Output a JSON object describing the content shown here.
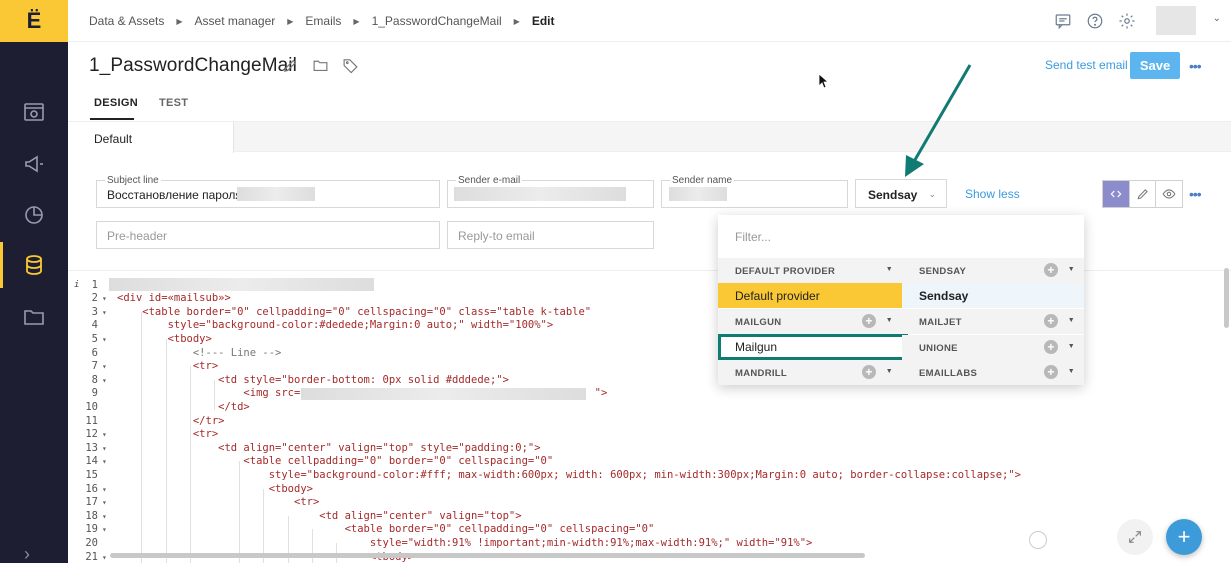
{
  "breadcrumbs": [
    "Data & Assets",
    "Asset manager",
    "Emails",
    "1_PasswordChangeMail"
  ],
  "breadcrumb_current": "Edit",
  "title": "1_PasswordChangeMail",
  "actions": {
    "send_test": "Send test email",
    "save": "Save"
  },
  "tabs": {
    "design": "DESIGN",
    "test": "TEST"
  },
  "variant_tab": "Default",
  "form": {
    "subject_label": "Subject line",
    "subject_value": "Восстановление пароля",
    "sender_email_label": "Sender e-mail",
    "sender_name_label": "Sender name",
    "provider_selected": "Sendsay",
    "show_less": "Show less",
    "preheader_placeholder": "Pre-header",
    "reply_to_placeholder": "Reply-to email"
  },
  "dropdown": {
    "filter_placeholder": "Filter...",
    "groups": {
      "default_provider": "DEFAULT PROVIDER",
      "sendsay": "SENDSAY",
      "mailgun": "MAILGUN",
      "mailjet": "MAILJET",
      "unione": "UNIONE",
      "mandrill": "MANDRILL",
      "emaillabs": "EMAILLABS"
    },
    "items": {
      "default_provider": "Default provider",
      "sendsay": "Sendsay",
      "mailgun": "Mailgun"
    },
    "plus": "+"
  },
  "editor": {
    "line_numbers": [
      "1",
      "2",
      "3",
      "4",
      "5",
      "6",
      "7",
      "8",
      "9",
      "10",
      "11",
      "12",
      "13",
      "14",
      "15",
      "16",
      "17",
      "18",
      "19",
      "20",
      "21"
    ],
    "lines": [
      "",
      "<div id=«mailsub»>",
      "    <table border=\"0\" cellpadding=\"0\" cellspacing=\"0\" class=\"table k-table\"",
      "        style=\"background-color:#dedede;Margin:0 auto;\" width=\"100%\">",
      "        <tbody>",
      "            <!--- Line -->",
      "            <tr>",
      "                <td style=\"border-bottom: 0px solid #dddede;\">",
      "                    <img src=\"",
      "                </td>",
      "            </tr>",
      "            <tr>",
      "                <td align=\"center\" valign=\"top\" style=\"padding:0;\">",
      "                    <table cellpadding=\"0\" border=\"0\" cellspacing=\"0\"",
      "                        style=\"background-color:#fff; max-width:600px; width: 600px; min-width:300px;Margin:0 auto; border-collapse:collapse;\">",
      "                        <tbody>",
      "                            <tr>",
      "                                <td align=\"center\" valign=\"top\">",
      "                                    <table border=\"0\" cellpadding=\"0\" cellspacing=\"0\"",
      "                                        style=\"width:91% !important;min-width:91%;max-width:91%;\" width=\"91%\">",
      "                                        <tbody>"
    ],
    "img_tail": "\">"
  },
  "logo_letter": "Ё",
  "fab_plus": "+",
  "colors": {
    "brand_yellow": "#f9c834",
    "rail": "#1e1e33",
    "accent_blue": "#3a9be0",
    "annotation_teal": "#0f7b72"
  }
}
